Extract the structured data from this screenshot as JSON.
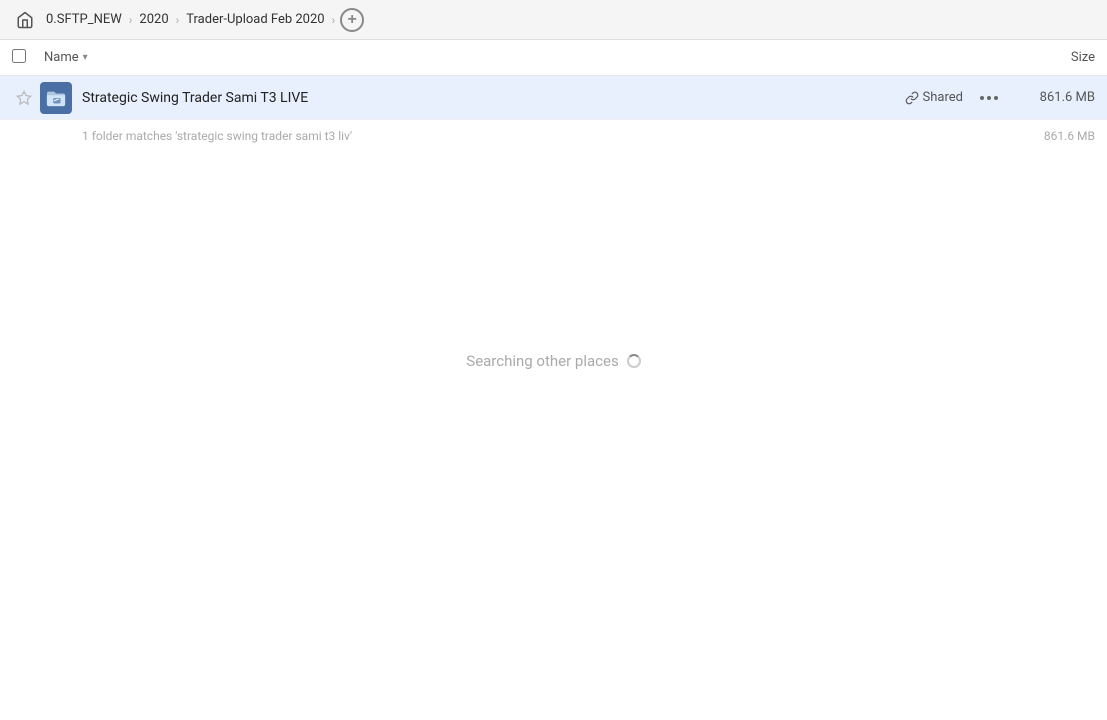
{
  "toolbar": {
    "home_icon": "🏠",
    "breadcrumbs": [
      {
        "label": "0.SFTP_NEW",
        "id": "bc-sftp"
      },
      {
        "label": "2020",
        "id": "bc-2020"
      },
      {
        "label": "Trader-Upload Feb 2020",
        "id": "bc-trader"
      }
    ],
    "add_button_label": "+",
    "separator": "›"
  },
  "column_header": {
    "name_label": "Name",
    "name_sort_icon": "▾",
    "size_label": "Size"
  },
  "file_row": {
    "folder_name": "Strategic Swing Trader Sami T3 LIVE",
    "shared_label": "Shared",
    "more_icon": "•••",
    "file_size": "861.6 MB"
  },
  "summary": {
    "text": "1 folder matches 'strategic swing trader sami t3 liv'",
    "size": "861.6 MB"
  },
  "searching": {
    "text": "Searching other places"
  }
}
